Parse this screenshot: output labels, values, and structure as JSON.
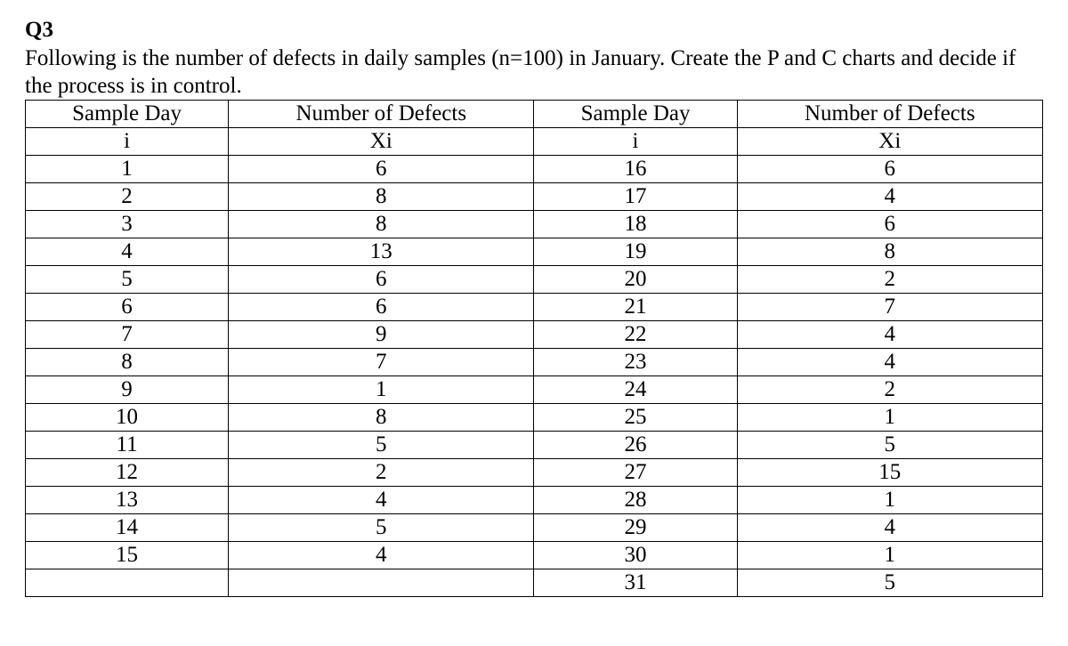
{
  "question_label": "Q3",
  "question_text": "Following is the number of defects in daily samples (n=100) in January. Create the P and C charts and decide if the process is in control.",
  "headers": {
    "col1_line1": "Sample Day",
    "col1_line2": "i",
    "col2_line1": "Number of Defects",
    "col2_line2": "Xi",
    "col3_line1": "Sample Day",
    "col3_line2": "i",
    "col4_line1": "Number of Defects",
    "col4_line2": "Xi"
  },
  "rows": [
    {
      "c1": "1",
      "c2": "6",
      "c3": "16",
      "c4": "6"
    },
    {
      "c1": "2",
      "c2": "8",
      "c3": "17",
      "c4": "4"
    },
    {
      "c1": "3",
      "c2": "8",
      "c3": "18",
      "c4": "6"
    },
    {
      "c1": "4",
      "c2": "13",
      "c3": "19",
      "c4": "8"
    },
    {
      "c1": "5",
      "c2": "6",
      "c3": "20",
      "c4": "2"
    },
    {
      "c1": "6",
      "c2": "6",
      "c3": "21",
      "c4": "7"
    },
    {
      "c1": "7",
      "c2": "9",
      "c3": "22",
      "c4": "4"
    },
    {
      "c1": "8",
      "c2": "7",
      "c3": "23",
      "c4": "4"
    },
    {
      "c1": "9",
      "c2": "1",
      "c3": "24",
      "c4": "2"
    },
    {
      "c1": "10",
      "c2": "8",
      "c3": "25",
      "c4": "1"
    },
    {
      "c1": "11",
      "c2": "5",
      "c3": "26",
      "c4": "5"
    },
    {
      "c1": "12",
      "c2": "2",
      "c3": "27",
      "c4": "15"
    },
    {
      "c1": "13",
      "c2": "4",
      "c3": "28",
      "c4": "1"
    },
    {
      "c1": "14",
      "c2": "5",
      "c3": "29",
      "c4": "4"
    },
    {
      "c1": "15",
      "c2": "4",
      "c3": "30",
      "c4": "1"
    },
    {
      "c1": "",
      "c2": "",
      "c3": "31",
      "c4": "5"
    }
  ]
}
